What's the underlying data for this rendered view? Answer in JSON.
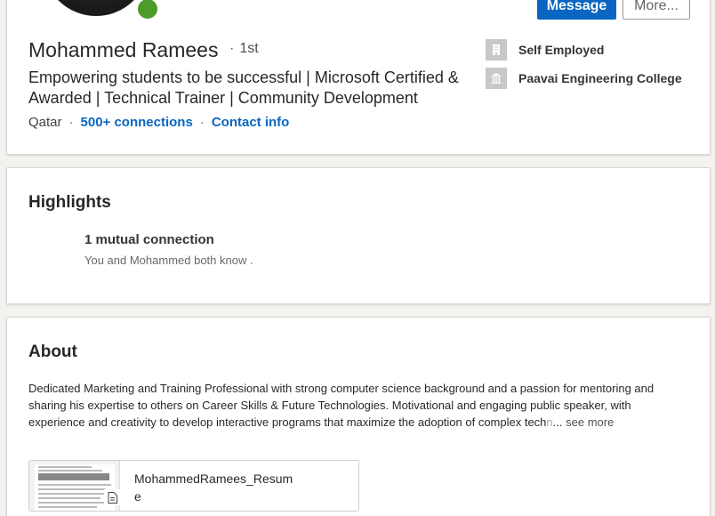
{
  "profile": {
    "name": "Mohammed Ramees",
    "degree_separator": "·",
    "degree": "1st",
    "headline": "Empowering students to be successful | Microsoft Certified & Awarded | Technical Trainer | Community Development",
    "location": "Qatar",
    "separator": "·",
    "connections": "500+ connections",
    "contact_info": "Contact info",
    "online_status_color": "#4e9a2a",
    "actions": {
      "message_label": "Message",
      "more_label": "More..."
    },
    "experience": [
      {
        "label": "Self Employed",
        "icon": "building-icon"
      },
      {
        "label": "Paavai Engineering College",
        "icon": "school-icon"
      }
    ]
  },
  "highlights": {
    "title": "Highlights",
    "mutual_title": "1 mutual connection",
    "mutual_subtitle": "You and Mohammed both know ."
  },
  "about": {
    "title": "About",
    "text": "Dedicated Marketing and Training Professional with strong computer science background and a passion for mentoring and sharing his expertise to others on Career Skills & Future Technologies. Motivational and engaging public speaker, with experience and creativity to develop interactive programs that maximize the adoption of complex tech",
    "text_fade": "n",
    "ellipsis": "...",
    "see_more": "see more",
    "attachment": {
      "file_name": "MohammedRamees_Resume",
      "icon": "document-icon"
    }
  },
  "colors": {
    "accent": "#0a66c2",
    "background": "#f3f2ef"
  }
}
